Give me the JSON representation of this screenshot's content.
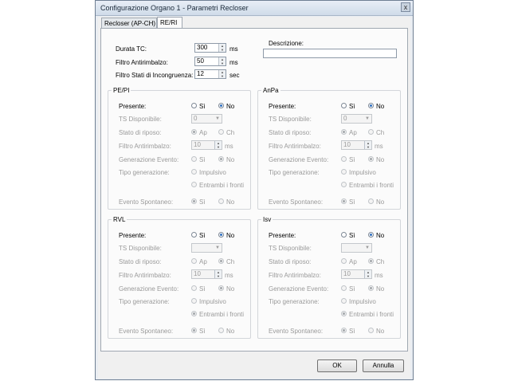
{
  "window": {
    "title": "Configurazione Organo 1 - Parametri Recloser",
    "close_glyph": "x"
  },
  "tabs": [
    {
      "label": "Recloser (AP-CH)"
    },
    {
      "label": "RE/RI"
    }
  ],
  "top": {
    "durata_label": "Durata TC:",
    "durata_value": "300",
    "durata_unit": "ms",
    "filtro_label": "Filtro Antirimbalzo:",
    "filtro_value": "50",
    "filtro_unit": "ms",
    "incongruenza_label": "Filtro Stati di Incongruenza:",
    "incongruenza_value": "12",
    "incongruenza_unit": "sec",
    "descrizione_label": "Descrizione:",
    "descrizione_value": ""
  },
  "common": {
    "presente": "Presente:",
    "ts": "TS Disponibile:",
    "stato": "Stato di riposo:",
    "filtro": "Filtro Antirimbalzo:",
    "gen": "Generazione Evento:",
    "tipo": "Tipo generazione:",
    "evento": "Evento Spontaneo:",
    "si": "Sì",
    "no": "No",
    "ap": "Ap",
    "ch": "Ch",
    "impulsivo": "Impulsivo",
    "entrambi": "Entrambi i fronti",
    "ms": "ms"
  },
  "groups": {
    "pepi": {
      "title": "PE/PI",
      "ts_value": "0",
      "filtro_value": "10"
    },
    "anpa": {
      "title": "AnPa",
      "ts_value": "0",
      "filtro_value": "10"
    },
    "rvl": {
      "title": "RVL",
      "ts_value": "",
      "filtro_value": "10"
    },
    "isv": {
      "title": "Isv",
      "ts_value": "",
      "filtro_value": "10"
    }
  },
  "buttons": {
    "ok": "OK",
    "annulla": "Annulla"
  },
  "icons": {
    "spin_up": "▲",
    "spin_down": "▼",
    "combo": "▼"
  }
}
